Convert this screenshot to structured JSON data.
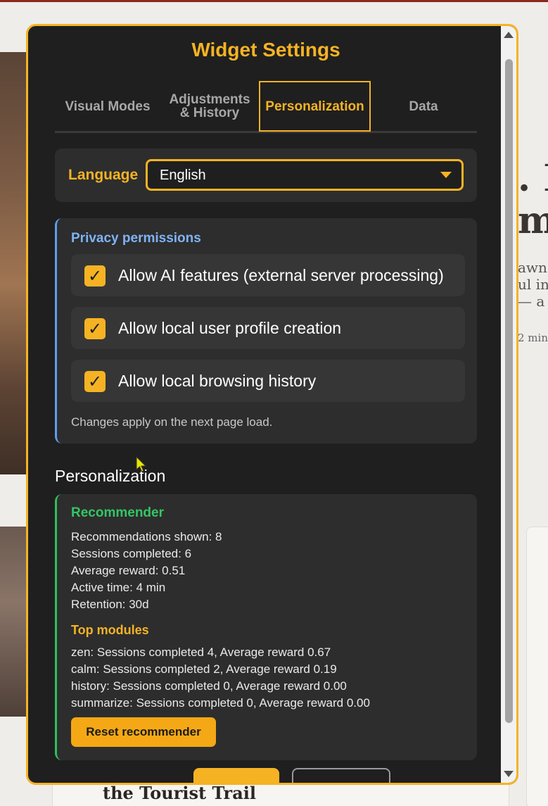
{
  "background": {
    "headline_fragment_1": ". H",
    "headline_fragment_2": "ma",
    "excerpt_line_1": "awn",
    "excerpt_line_2": "ul in",
    "excerpt_line_3": "— a",
    "read_time_fragment": "2 min",
    "bottom_card_title": "the Tourist Trail"
  },
  "modal": {
    "title": "Widget Settings",
    "tabs": [
      {
        "label": "Visual Modes",
        "active": false
      },
      {
        "label": "Adjustments & History",
        "active": false
      },
      {
        "label": "Personalization",
        "active": true
      },
      {
        "label": "Data",
        "active": false
      }
    ],
    "language": {
      "label": "Language",
      "selected": "English"
    },
    "privacy": {
      "heading": "Privacy permissions",
      "permissions": [
        {
          "label": "Allow AI features (external server processing)",
          "checked": true
        },
        {
          "label": "Allow local user profile creation",
          "checked": true
        },
        {
          "label": "Allow local browsing history",
          "checked": true
        }
      ],
      "note": "Changes apply on the next page load."
    },
    "personalization": {
      "section_title": "Personalization",
      "recommender": {
        "heading": "Recommender",
        "stats": [
          "Recommendations shown: 8",
          "Sessions completed: 6",
          "Average reward: 0.51",
          "Active time: 4 min",
          "Retention: 30d"
        ],
        "top_modules_heading": "Top modules",
        "modules": [
          "zen: Sessions completed 4, Average reward 0.67",
          "calm: Sessions completed 2, Average reward 0.19",
          "history: Sessions completed 0, Average reward 0.00",
          "summarize: Sessions completed 0, Average reward 0.00"
        ],
        "reset_label": "Reset recommender"
      }
    }
  },
  "colors": {
    "accent": "#f5b324",
    "panel_bg": "#2d2d2d",
    "modal_bg": "#1f1f1f",
    "privacy_border": "#5c9ef0",
    "recommender_border": "#2fbf5f"
  },
  "icons": {
    "checkbox_check": "check-icon",
    "select_caret": "caret-down-icon",
    "scroll_up": "arrow-up-icon",
    "scroll_down": "arrow-down-icon"
  }
}
